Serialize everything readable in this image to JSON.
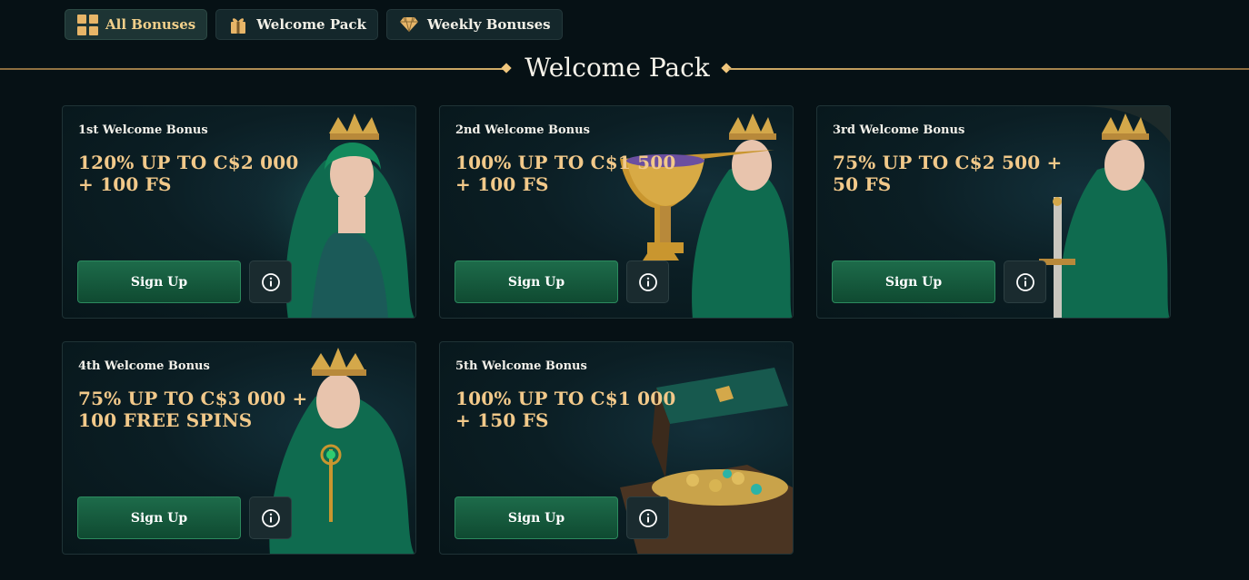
{
  "tabs": [
    {
      "label": "All Bonuses",
      "icon": "grid-icon",
      "active": true
    },
    {
      "label": "Welcome Pack",
      "icon": "gift-icon",
      "active": false
    },
    {
      "label": "Weekly Bonuses",
      "icon": "diamond-icon",
      "active": false
    }
  ],
  "section": {
    "title": "Welcome Pack"
  },
  "cards": [
    {
      "title": "1st Welcome Bonus",
      "offer": "120% UP TO C$2 000 + 100 FS",
      "button": "Sign Up",
      "art": "elf-queen-icon"
    },
    {
      "title": "2nd Welcome Bonus",
      "offer": "100% UP TO C$1 500 + 100 FS",
      "button": "Sign Up",
      "art": "elf-queen-with-trophy-icon"
    },
    {
      "title": "3rd Welcome Bonus",
      "offer": "75% UP TO C$2 500 + 50 FS",
      "button": "Sign Up",
      "art": "elf-queen-with-sword-icon"
    },
    {
      "title": "4th Welcome Bonus",
      "offer": "75% UP TO C$3 000 + 100 FREE SPINS",
      "button": "Sign Up",
      "art": "elf-queen-with-key-icon"
    },
    {
      "title": "5th Welcome Bonus",
      "offer": "100% UP TO C$1 000 + 150 FS",
      "button": "Sign Up",
      "art": "treasure-chest-icon"
    }
  ],
  "colors": {
    "background": "#061115",
    "accent_gold": "#f2c98a",
    "button_green": "#1d6b4a",
    "card_border": "#1f3336"
  }
}
